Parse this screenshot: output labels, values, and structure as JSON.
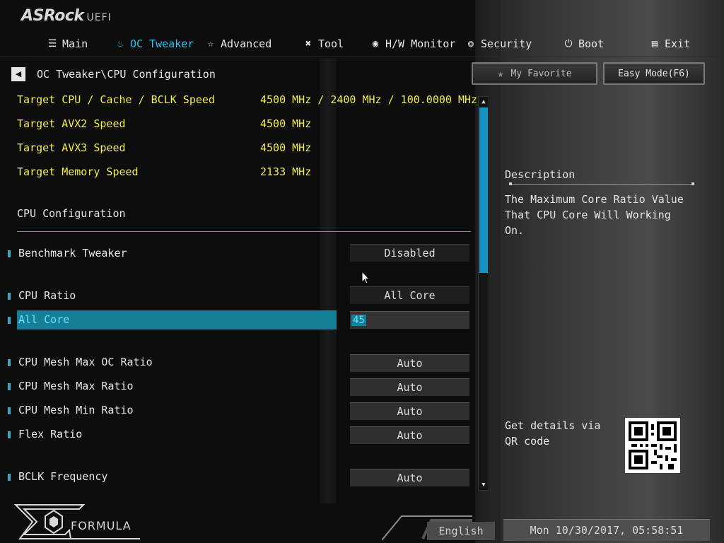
{
  "brand": {
    "name": "ASRock",
    "suffix": "UEFI"
  },
  "nav": [
    {
      "label": "Main",
      "icon": "list-icon"
    },
    {
      "label": "OC Tweaker",
      "icon": "flame-icon",
      "active": true
    },
    {
      "label": "Advanced",
      "icon": "star-outline-icon"
    },
    {
      "label": "Tool",
      "icon": "tools-icon"
    },
    {
      "label": "H/W Monitor",
      "icon": "monitor-gauge-icon"
    },
    {
      "label": "Security",
      "icon": "shield-icon"
    },
    {
      "label": "Boot",
      "icon": "power-icon"
    },
    {
      "label": "Exit",
      "icon": "exit-door-icon"
    }
  ],
  "breadcrumb": "OC Tweaker\\CPU Configuration",
  "buttons": {
    "favorite": "My Favorite",
    "easy_mode": "Easy Mode(F6)"
  },
  "targets": [
    {
      "label": "Target CPU / Cache / BCLK Speed",
      "value": "4500 MHz / 2400 MHz / 100.0000 MHz"
    },
    {
      "label": "Target AVX2 Speed",
      "value": "4500 MHz"
    },
    {
      "label": "Target AVX3 Speed",
      "value": "4500 MHz"
    },
    {
      "label": "Target Memory Speed",
      "value": "2133 MHz"
    }
  ],
  "section_title": "CPU Configuration",
  "settings": [
    {
      "label": "Benchmark Tweaker",
      "value": "Disabled"
    },
    {
      "label": "CPU Ratio",
      "value": "All Core"
    },
    {
      "label": "All Core",
      "value": "45"
    },
    {
      "label": "CPU Mesh Max OC Ratio",
      "value": "Auto"
    },
    {
      "label": "CPU Mesh Max Ratio",
      "value": "Auto"
    },
    {
      "label": "CPU Mesh Min Ratio",
      "value": "Auto"
    },
    {
      "label": "Flex Ratio",
      "value": "Auto"
    },
    {
      "label": "BCLK Frequency",
      "value": "Auto"
    }
  ],
  "description": {
    "title": "Description",
    "text": "The Maximum Core Ratio Value That CPU Core Will Working On.",
    "qr_text": "Get details via QR code"
  },
  "footer": {
    "brand": "FORMULA",
    "language": "English",
    "clock": "Mon 10/30/2017, 05:58:51"
  },
  "colors": {
    "accent": "#28c3ea",
    "highlight": "#157f97",
    "target_text": "#f2ee4b"
  }
}
